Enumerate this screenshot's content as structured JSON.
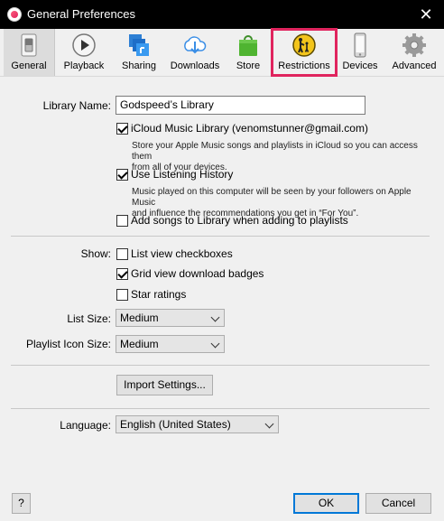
{
  "window": {
    "title": "General Preferences"
  },
  "toolbar": {
    "items": [
      {
        "label": "General",
        "icon": "general-switch-icon"
      },
      {
        "label": "Playback",
        "icon": "play-icon"
      },
      {
        "label": "Sharing",
        "icon": "sharing-icon"
      },
      {
        "label": "Downloads",
        "icon": "download-cloud-icon"
      },
      {
        "label": "Store",
        "icon": "store-bag-icon"
      },
      {
        "label": "Restrictions",
        "icon": "parental-restrictions-icon"
      },
      {
        "label": "Devices",
        "icon": "phone-icon"
      },
      {
        "label": "Advanced",
        "icon": "gear-icon"
      }
    ],
    "selected": "General",
    "highlight_color": "#e0245e"
  },
  "general": {
    "library_name_label": "Library Name:",
    "library_name_value": "Godspeed’s Library",
    "icloud": {
      "label": "iCloud Music Library (venomstunner@gmail.com)",
      "checked": true,
      "description_line1": "Store your Apple Music songs and playlists in iCloud so you can access them",
      "description_line2": "from all of your devices."
    },
    "listening_history": {
      "label": "Use Listening History",
      "checked": true,
      "description_line1": "Music played on this computer will be seen by your followers on Apple Music",
      "description_line2": "and influence the recommendations you get in “For You”."
    },
    "add_songs": {
      "label": "Add songs to Library when adding to playlists",
      "checked": false
    },
    "show_label": "Show:",
    "list_view": {
      "label": "List view checkboxes",
      "checked": false
    },
    "grid_badges": {
      "label": "Grid view download badges",
      "checked": true
    },
    "star_ratings": {
      "label": "Star ratings",
      "checked": false
    },
    "list_size_label": "List Size:",
    "list_size_value": "Medium",
    "playlist_icon_label": "Playlist Icon Size:",
    "playlist_icon_value": "Medium",
    "import_button": "Import Settings...",
    "language_label": "Language:",
    "language_value": "English (United States)"
  },
  "footer": {
    "help": "?",
    "ok": "OK",
    "cancel": "Cancel"
  }
}
